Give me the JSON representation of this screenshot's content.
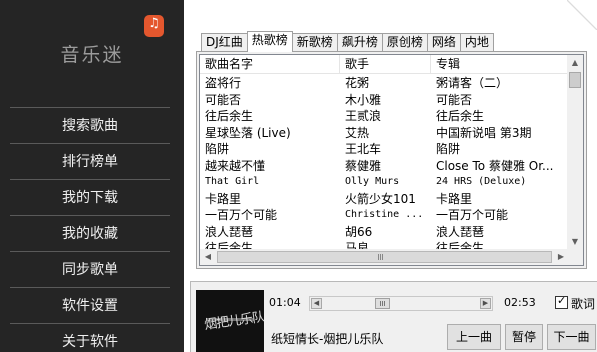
{
  "app": {
    "title": "音乐迷",
    "icon": "music-note-icon"
  },
  "sidebar": {
    "items": [
      {
        "label": "搜索歌曲"
      },
      {
        "label": "排行榜单"
      },
      {
        "label": "我的下载"
      },
      {
        "label": "我的收藏"
      },
      {
        "label": "同步歌单"
      },
      {
        "label": "软件设置"
      },
      {
        "label": "关于软件"
      }
    ]
  },
  "tabs": [
    "DJ红曲",
    "热歌榜",
    "新歌榜",
    "飙升榜",
    "原创榜",
    "网络",
    "内地"
  ],
  "active_tab": "热歌榜",
  "list": {
    "columns": [
      "歌曲名字",
      "歌手",
      "专辑"
    ],
    "rows": [
      [
        "盗将行",
        "花粥",
        "粥请客（二）"
      ],
      [
        "可能否",
        "木小雅",
        "可能否"
      ],
      [
        "往后余生",
        "王贰浪",
        "往后余生"
      ],
      [
        "星球坠落 (Live)",
        "艾热",
        "中国新说唱 第3期"
      ],
      [
        "陷阱",
        "王北车",
        "陷阱"
      ],
      [
        "越来越不懂",
        "蔡健雅",
        "Close To 蔡健雅 Or..."
      ],
      [
        "That Girl",
        "Olly Murs",
        "24 HRS (Deluxe)"
      ],
      [
        "卡路里",
        "火箭少女101",
        "卡路里"
      ],
      [
        "一百万个可能",
        "Christine ...",
        "一百万个可能"
      ],
      [
        "浪人琵琶",
        "胡66",
        "浪人琵琶"
      ],
      [
        "往后余生",
        "马良",
        "往后余生"
      ]
    ]
  },
  "player": {
    "elapsed": "01:04",
    "total": "02:53",
    "progress": 0.37,
    "lyrics_label": "歌词",
    "lyrics_checked": true,
    "now_playing": "纸短情长-烟把儿乐队",
    "cover_text": "烟把儿乐队",
    "prev_label": "上一曲",
    "pause_label": "暂停",
    "next_label": "下一曲"
  }
}
